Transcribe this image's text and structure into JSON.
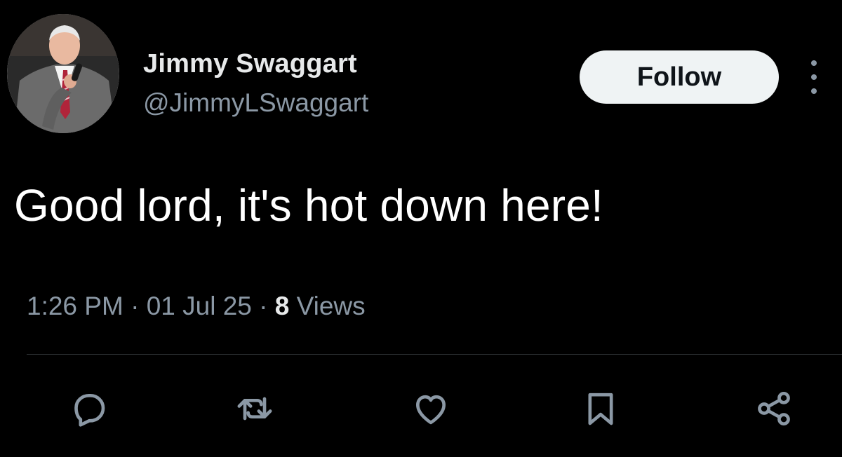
{
  "author": {
    "display_name": "Jimmy Swaggart",
    "handle": "@JimmyLSwaggart"
  },
  "follow_label": "Follow",
  "tweet": {
    "text": "Good lord, it's hot down here!",
    "time": "1:26 PM",
    "separator": "·",
    "date": "01 Jul 25",
    "views_count": "8",
    "views_label": "Views"
  },
  "actions": [
    {
      "icon": "reply-icon"
    },
    {
      "icon": "retweet-icon"
    },
    {
      "icon": "like-icon"
    },
    {
      "icon": "bookmark-icon"
    },
    {
      "icon": "share-icon"
    }
  ],
  "colors": {
    "background": "#000000",
    "primary_text": "#e7e9ea",
    "secondary_text": "#8b98a5",
    "divider": "#2f3336",
    "follow_bg": "#eff3f4"
  }
}
